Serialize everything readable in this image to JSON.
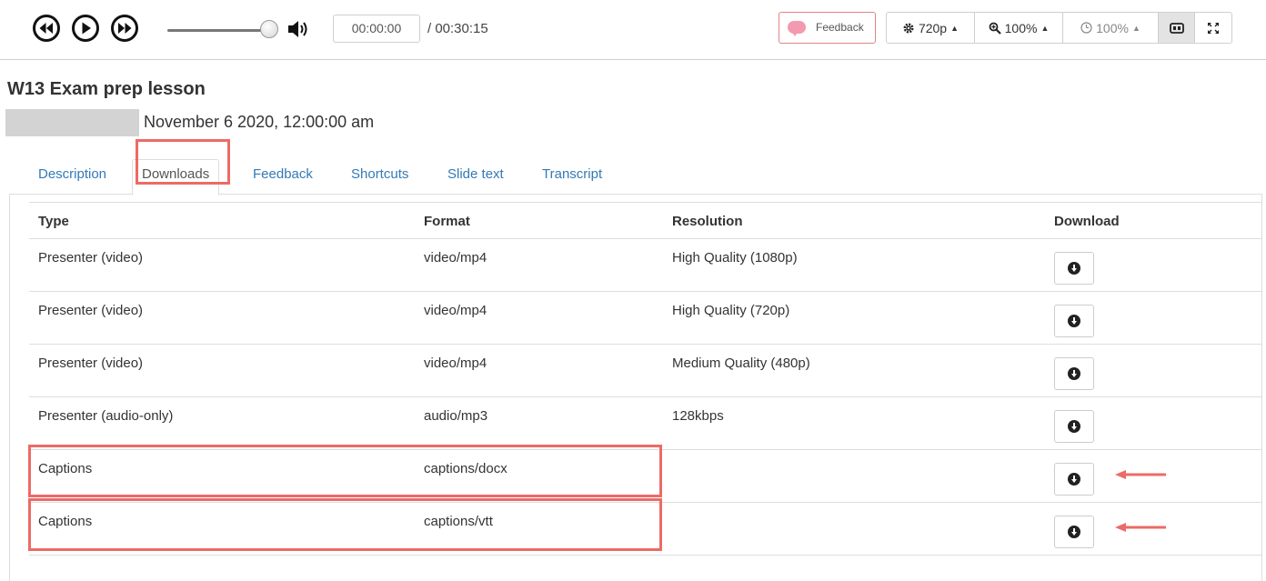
{
  "toolbar": {
    "current_time": "00:00:00",
    "total_time": "/ 00:30:15",
    "feedback_label": "Feedback",
    "quality_label": "720p",
    "zoom_label": "100%",
    "speed_label": "100%",
    "volume_level": 0.9
  },
  "lesson": {
    "title": "W13 Exam prep lesson",
    "date": "November 6 2020, 12:00:00 am"
  },
  "tabs": [
    {
      "label": "Description"
    },
    {
      "label": "Downloads",
      "active": true
    },
    {
      "label": "Feedback"
    },
    {
      "label": "Shortcuts"
    },
    {
      "label": "Slide text"
    },
    {
      "label": "Transcript"
    }
  ],
  "downloads": {
    "headers": [
      "Type",
      "Format",
      "Resolution",
      "Download"
    ],
    "rows": [
      {
        "type": "Presenter (video)",
        "format": "video/mp4",
        "resolution": "High Quality (1080p)"
      },
      {
        "type": "Presenter (video)",
        "format": "video/mp4",
        "resolution": "High Quality (720p)"
      },
      {
        "type": "Presenter (video)",
        "format": "video/mp4",
        "resolution": "Medium Quality (480p)"
      },
      {
        "type": "Presenter (audio-only)",
        "format": "audio/mp3",
        "resolution": "128kbps"
      },
      {
        "type": "Captions",
        "format": "captions/docx",
        "resolution": ""
      },
      {
        "type": "Captions",
        "format": "captions/vtt",
        "resolution": ""
      }
    ]
  },
  "colors": {
    "highlight": "#ec6b66",
    "link": "#337ab7"
  }
}
